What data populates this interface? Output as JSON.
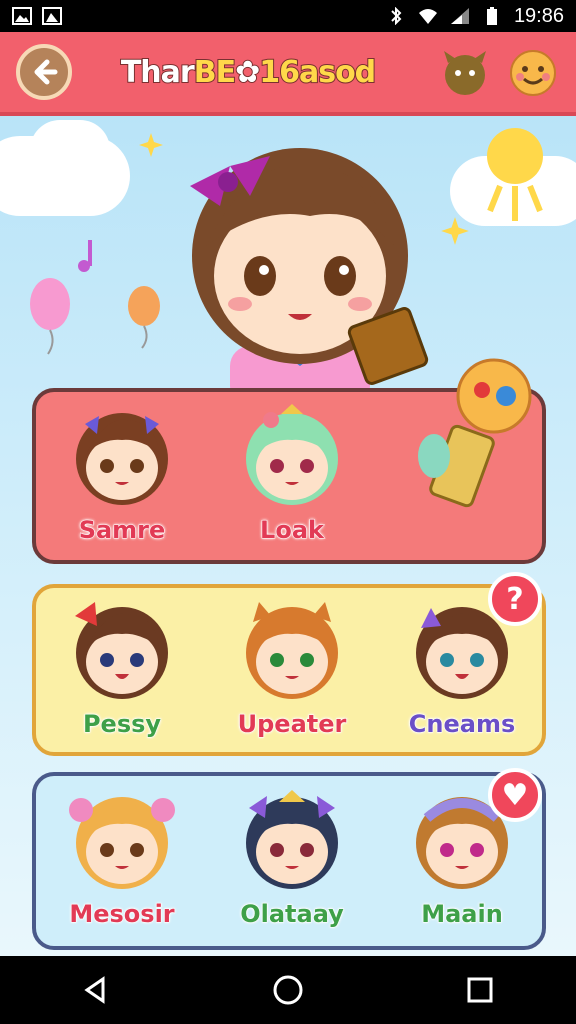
{
  "status_bar": {
    "time": "19:86",
    "icons": [
      "gallery-icon",
      "image-icon",
      "bluetooth-icon",
      "wifi-icon",
      "signal-icon",
      "battery-icon"
    ]
  },
  "header": {
    "back_icon": "back-arrow-icon",
    "title_part1": "Thar",
    "title_part2": "BE",
    "title_part3": "16asod",
    "icons": [
      "pet-icon",
      "smiley-icon"
    ]
  },
  "cards": [
    {
      "characters": [
        {
          "name": "Samre",
          "hair": "#7a3f22",
          "accent": "#6a5ad8",
          "label_color": "red"
        },
        {
          "name": "Loak",
          "hair": "#8ee0b0",
          "accent": "#f0c84a",
          "label_color": "red"
        }
      ],
      "item_icon": "key-item-icon"
    },
    {
      "characters": [
        {
          "name": "Pessy",
          "hair": "#6b3a22",
          "accent": "#e23a3a",
          "label_color": "green"
        },
        {
          "name": "Upeater",
          "hair": "#d77a2e",
          "accent": "#f0a070",
          "label_color": "red"
        },
        {
          "name": "Cneams",
          "hair": "#6b3a22",
          "accent": "#8a5ad8",
          "label_color": "purple"
        }
      ],
      "badge": "?"
    },
    {
      "characters": [
        {
          "name": "Mesosir",
          "hair": "#f0b04a",
          "accent": "#f08ac0",
          "label_color": "red"
        },
        {
          "name": "Olataay",
          "hair": "#2e3a5a",
          "accent": "#f0c84a",
          "label_color": "green"
        },
        {
          "name": "Maain",
          "hair": "#c07a30",
          "accent": "#9a8ae0",
          "label_color": "green"
        }
      ],
      "badge": "♥"
    }
  ],
  "nav_bar": {
    "icons": [
      "back-triangle-icon",
      "home-circle-icon",
      "recents-square-icon"
    ]
  },
  "colors": {
    "header": "#f2606c",
    "card_1": "#f47a7a",
    "card_2": "#fbf0a6",
    "card_3": "#cfeefa"
  }
}
